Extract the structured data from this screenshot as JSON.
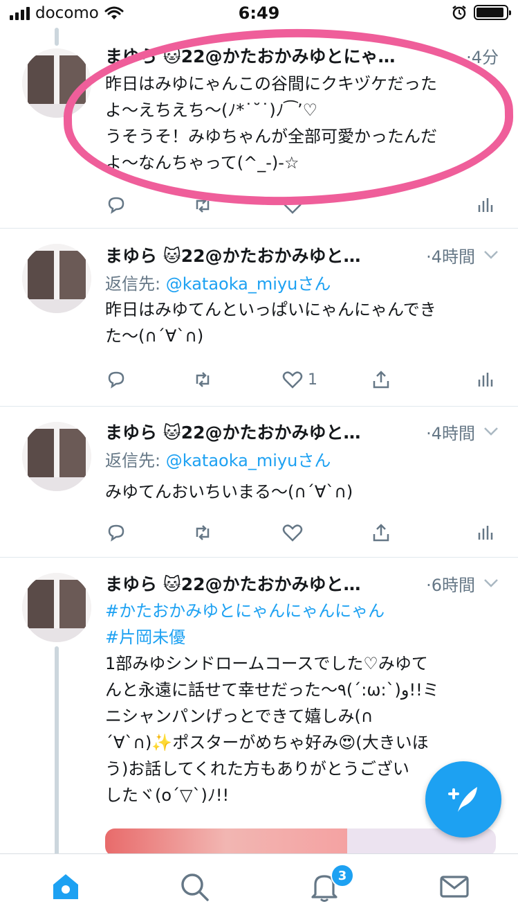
{
  "status_bar": {
    "carrier": "docomo",
    "time": "6:49"
  },
  "tweets": [
    {
      "name": "まゆら 🐱22@かたおかみゆとにゃ…",
      "time": "·4分",
      "body": [
        "昨日はみゆにゃんこの谷間にクキヅケだった",
        "よ〜えちえち〜(ﾉ*˙˘˙)ﾉ⁀’♡",
        "うそうそ！みゆちゃんが全部可愛かったんだ",
        "よ〜なんちゃって(^_-)-☆"
      ]
    },
    {
      "name": "まゆら 🐱22@かたおかみゆと…",
      "time": "·4時間",
      "reply_prefix": "返信先: ",
      "reply_mention": "@kataoka_miyuさん",
      "body": [
        "昨日はみゆてんといっぱいにゃんにゃんでき",
        "た〜(∩´∀`∩)"
      ],
      "like_count": "1"
    },
    {
      "name": "まゆら 🐱22@かたおかみゆと…",
      "time": "·4時間",
      "reply_prefix": "返信先: ",
      "reply_mention": "@kataoka_miyuさん",
      "body": [
        "みゆてんおいちいまる〜(∩´∀`∩)"
      ]
    },
    {
      "name": "まゆら 🐱22@かたおかみゆと…",
      "time": "·6時間",
      "hashtags": [
        "#かたおかみゆとにゃんにゃんにゃん",
        "#片岡未優"
      ],
      "body": [
        "1部みゆシンドロームコースでした♡みゆて",
        "んと永遠に話せて幸せだった〜٩(´:ω:`)و!!ミ",
        "ニシャンパンげっとできて嬉しみ(∩",
        "´∀`∩)✨ポスターがめちゃ好み😍(大きいほ",
        "う)お話してくれた方もありがとうござい",
        "したヾ(o´▽`)ﾉ!!"
      ]
    }
  ],
  "tab_bar": {
    "notifications_badge": "3"
  },
  "colors": {
    "accent": "#1da1f2",
    "highlight": "#ef5e9a",
    "muted": "#657786"
  }
}
